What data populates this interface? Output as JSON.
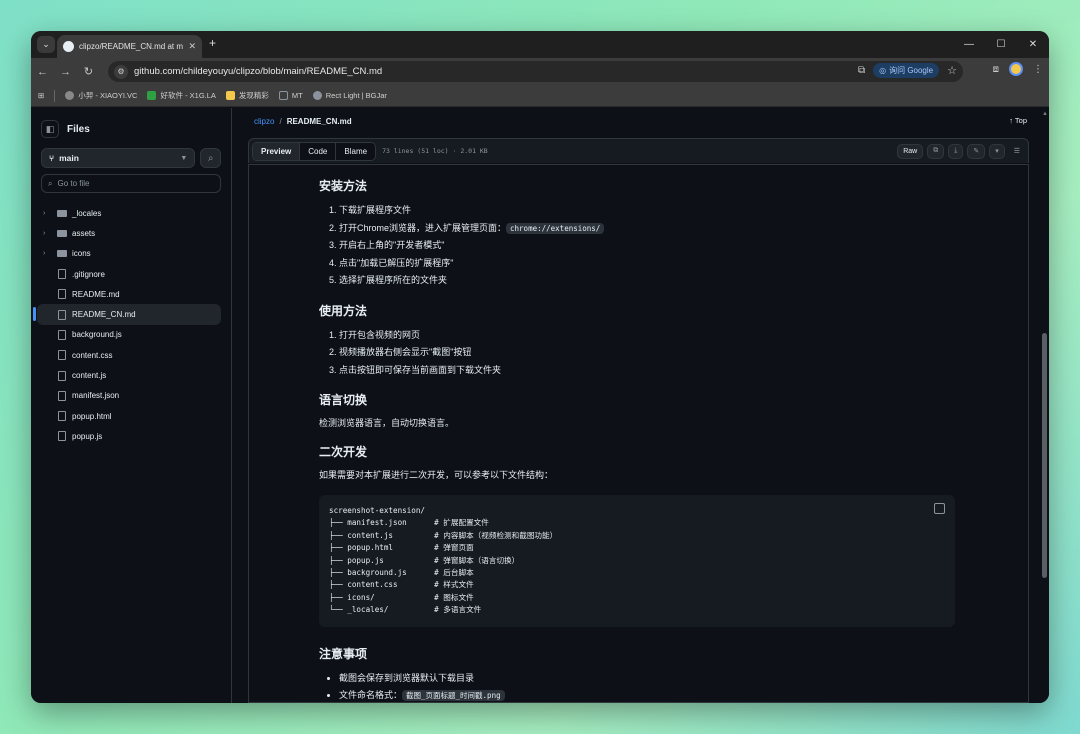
{
  "browser": {
    "tab_title": "clipzo/README_CN.md at m",
    "url": "github.com/childeyouyu/clipzo/blob/main/README_CN.md",
    "ask_google": "询问 Google",
    "bookmarks": [
      {
        "label": "小羿 - XIAOYI.VC",
        "color": "#888888"
      },
      {
        "label": "好软件 - X1G.LA",
        "color": "#2ea043"
      },
      {
        "label": "发现精彩",
        "color": "#f2c94c"
      },
      {
        "label": "MT",
        "color": "#8b949e"
      },
      {
        "label": "Rect Light | BGJar",
        "color": "#8b949e"
      }
    ]
  },
  "sidebar": {
    "title": "Files",
    "branch": "main",
    "goto_placeholder": "Go to file",
    "items": [
      {
        "label": "_locales",
        "type": "folder"
      },
      {
        "label": "assets",
        "type": "folder"
      },
      {
        "label": "icons",
        "type": "folder"
      },
      {
        "label": ".gitignore",
        "type": "file"
      },
      {
        "label": "README.md",
        "type": "file"
      },
      {
        "label": "README_CN.md",
        "type": "file",
        "active": true
      },
      {
        "label": "background.js",
        "type": "file"
      },
      {
        "label": "content.css",
        "type": "file"
      },
      {
        "label": "content.js",
        "type": "file"
      },
      {
        "label": "manifest.json",
        "type": "file"
      },
      {
        "label": "popup.html",
        "type": "file"
      },
      {
        "label": "popup.js",
        "type": "file"
      }
    ]
  },
  "breadcrumb": {
    "repo": "clipzo",
    "file": "README_CN.md",
    "top": "Top"
  },
  "filebar": {
    "tabs": [
      "Preview",
      "Code",
      "Blame"
    ],
    "meta": "73 lines (51 loc) · 2.01 KB",
    "raw": "Raw"
  },
  "readme": {
    "install_title": "安装方法",
    "install_steps": [
      "下载扩展程序文件",
      "打开Chrome浏览器，进入扩展管理页面：",
      "开启右上角的\"开发者模式\"",
      "点击\"加载已解压的扩展程序\"",
      "选择扩展程序所在的文件夹"
    ],
    "install_code": "chrome://extensions/",
    "usage_title": "使用方法",
    "usage_steps": [
      "打开包含视频的网页",
      "视频播放器右侧会显示\"截图\"按钮",
      "点击按钮即可保存当前画面到下载文件夹"
    ],
    "lang_title": "语言切换",
    "lang_text": "检测浏览器语言，自动切换语言。",
    "dev_title": "二次开发",
    "dev_text": "如果需要对本扩展进行二次开发，可以参考以下文件结构：",
    "code_block": "screenshot-extension/\n├── manifest.json      # 扩展配置文件\n├── content.js         # 内容脚本（视频检测和截图功能）\n├── popup.html         # 弹窗页面\n├── popup.js           # 弹窗脚本（语言切换）\n├── background.js      # 后台脚本\n├── content.css        # 样式文件\n├── icons/             # 图标文件\n└── _locales/          # 多语言文件",
    "notes_title": "注意事项",
    "notes": [
      "截图会保存到浏览器默认下载目录",
      "文件命名格式："
    ],
    "notes_code": "截图_页面标题_时间戳.png"
  }
}
